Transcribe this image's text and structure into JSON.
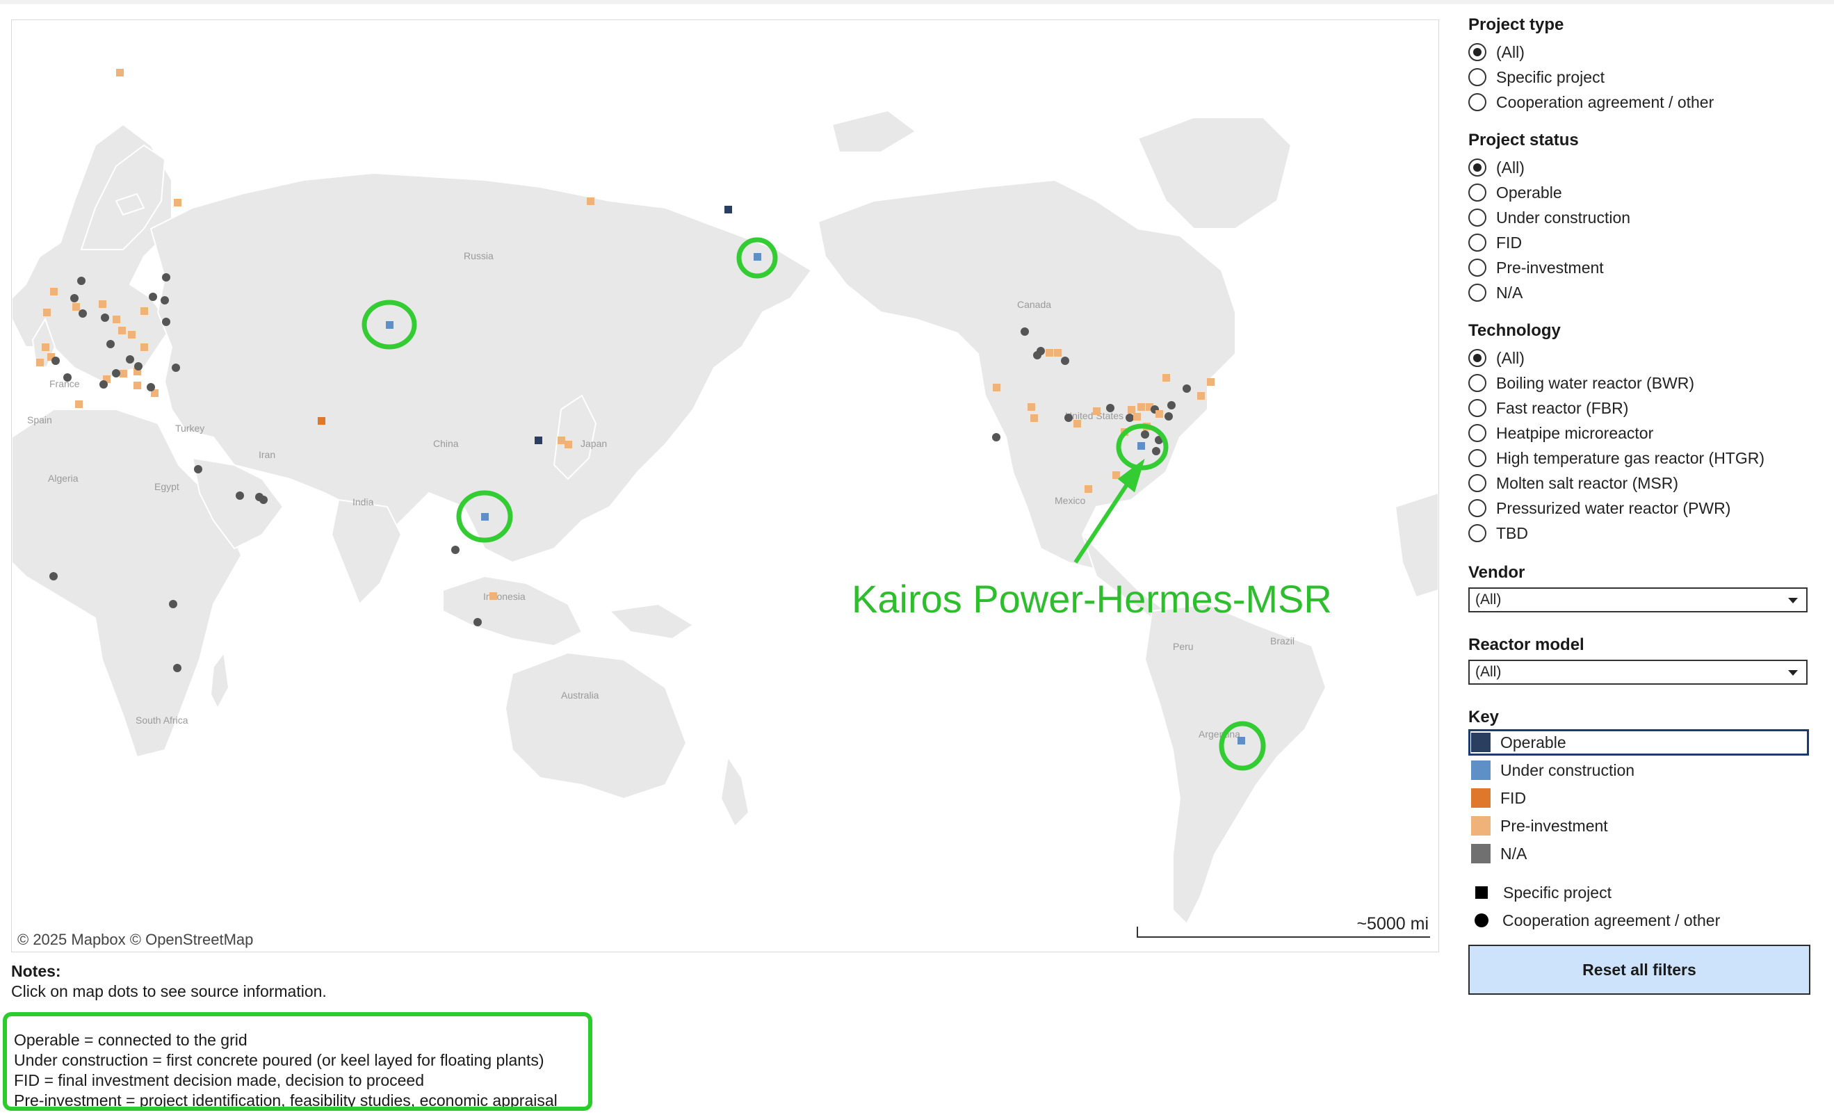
{
  "map": {
    "attribution": "© 2025 Mapbox  © OpenStreetMap",
    "scale_label": "~5000 mi",
    "place_labels": [
      {
        "name": "Russia"
      },
      {
        "name": "China"
      },
      {
        "name": "India"
      },
      {
        "name": "Iran"
      },
      {
        "name": "Turkey"
      },
      {
        "name": "Egypt"
      },
      {
        "name": "Algeria"
      },
      {
        "name": "Spain"
      },
      {
        "name": "France"
      },
      {
        "name": "Japan"
      },
      {
        "name": "Indonesia"
      },
      {
        "name": "Australia"
      },
      {
        "name": "South Africa"
      },
      {
        "name": "Canada"
      },
      {
        "name": "United States"
      },
      {
        "name": "Mexico"
      },
      {
        "name": "Peru"
      },
      {
        "name": "Brazil"
      },
      {
        "name": "Argentina"
      }
    ],
    "callout_text": "Kairos Power-Hermes-MSR",
    "colors": {
      "land": "#e8e8e8",
      "border": "#ffffff",
      "operable": "#2a3f5f",
      "under_construction": "#5f8fc7",
      "fid": "#e0782c",
      "pre_investment": "#efb37a",
      "na": "#555555",
      "highlight": "#33cc33"
    }
  },
  "notes": {
    "heading": "Notes:",
    "line": "Click on map dots to see source information.",
    "definitions": [
      "Operable = connected to the grid",
      "Under construction = first concrete poured (or keel layed for floating plants)",
      "FID = final investment decision made, decision to proceed",
      "Pre-investment = project identification, feasibility studies, economic appraisal"
    ]
  },
  "filters": {
    "project_type": {
      "title": "Project type",
      "options": [
        "(All)",
        "Specific project",
        "Cooperation agreement / other"
      ],
      "selected": 0
    },
    "project_status": {
      "title": "Project status",
      "options": [
        "(All)",
        "Operable",
        "Under construction",
        "FID",
        "Pre-investment",
        "N/A"
      ],
      "selected": 0
    },
    "technology": {
      "title": "Technology",
      "options": [
        "(All)",
        "Boiling water reactor (BWR)",
        "Fast reactor (FBR)",
        "Heatpipe microreactor",
        "High temperature gas reactor (HTGR)",
        "Molten salt reactor (MSR)",
        "Pressurized water reactor (PWR)",
        "TBD"
      ],
      "selected": 0
    },
    "vendor": {
      "title": "Vendor",
      "value": "(All)"
    },
    "reactor_model": {
      "title": "Reactor model",
      "value": "(All)"
    }
  },
  "key": {
    "title": "Key",
    "statuses": [
      {
        "label": "Operable",
        "color": "#2a3f5f"
      },
      {
        "label": "Under construction",
        "color": "#5f8fc7"
      },
      {
        "label": "FID",
        "color": "#e0782c"
      },
      {
        "label": "Pre-investment",
        "color": "#efb37a"
      },
      {
        "label": "N/A",
        "color": "#707070"
      }
    ],
    "shapes": [
      {
        "label": "Specific project",
        "shape": "square"
      },
      {
        "label": "Cooperation agreement / other",
        "shape": "circle"
      }
    ]
  },
  "reset_label": "Reset all filters"
}
